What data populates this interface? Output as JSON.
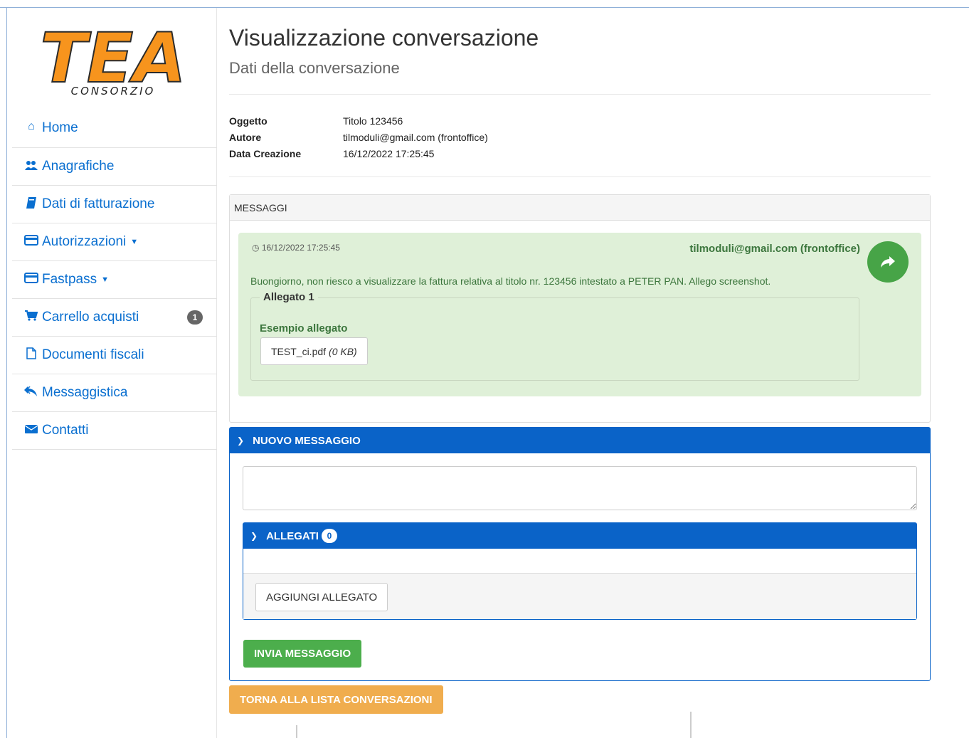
{
  "brand": {
    "logo_text": "TEA",
    "logo_subtext": "CONSORZIO",
    "logo_color": "#f7941d"
  },
  "sidebar": {
    "items": [
      {
        "label": "Home",
        "icon": "home-icon"
      },
      {
        "label": "Anagrafiche",
        "icon": "users-icon"
      },
      {
        "label": "Dati di fatturazione",
        "icon": "book-icon"
      },
      {
        "label": "Autorizzazioni",
        "icon": "credit-card-icon",
        "dropdown": true
      },
      {
        "label": "Fastpass",
        "icon": "credit-card-icon",
        "dropdown": true
      },
      {
        "label": "Carrello acquisti",
        "icon": "cart-icon",
        "badge": "1"
      },
      {
        "label": "Documenti fiscali",
        "icon": "file-icon"
      },
      {
        "label": "Messaggistica",
        "icon": "reply-all-icon"
      },
      {
        "label": "Contatti",
        "icon": "envelope-icon"
      }
    ]
  },
  "page": {
    "title": "Visualizzazione conversazione",
    "subtitle": "Dati della conversazione"
  },
  "meta": {
    "oggetto_label": "Oggetto",
    "oggetto_value": "Titolo 123456",
    "autore_label": "Autore",
    "autore_value": "tilmoduli@gmail.com (frontoffice)",
    "data_label": "Data Creazione",
    "data_value": "16/12/2022 17:25:45"
  },
  "messages_panel": {
    "header": "MESSAGGI",
    "message": {
      "time": "16/12/2022 17:25:45",
      "author": "tilmoduli@gmail.com (frontoffice)",
      "text": "Buongiorno, non riesco a visualizzare la fattura relativa al titolo nr. 123456 intestato a PETER PAN. Allego screenshot.",
      "attachment_legend": "Allegato 1",
      "attachment_name": "Esempio allegato",
      "attachment_file": "TEST_ci.pdf",
      "attachment_size": "(0 KB)"
    }
  },
  "new_message": {
    "header": "NUOVO MESSAGGIO",
    "input_value": "",
    "allegati_label": "ALLEGATI",
    "allegati_count": "0",
    "add_button": "AGGIUNGI ALLEGATO",
    "send_button": "INVIA MESSAGGIO"
  },
  "back_button": "TORNA ALLA LISTA CONVERSAZIONI",
  "colors": {
    "primary": "#0a63c8",
    "success": "#4cae4c",
    "warning": "#f0ad4e",
    "message_bg": "#dff0d8",
    "link": "#0a6fd0"
  }
}
